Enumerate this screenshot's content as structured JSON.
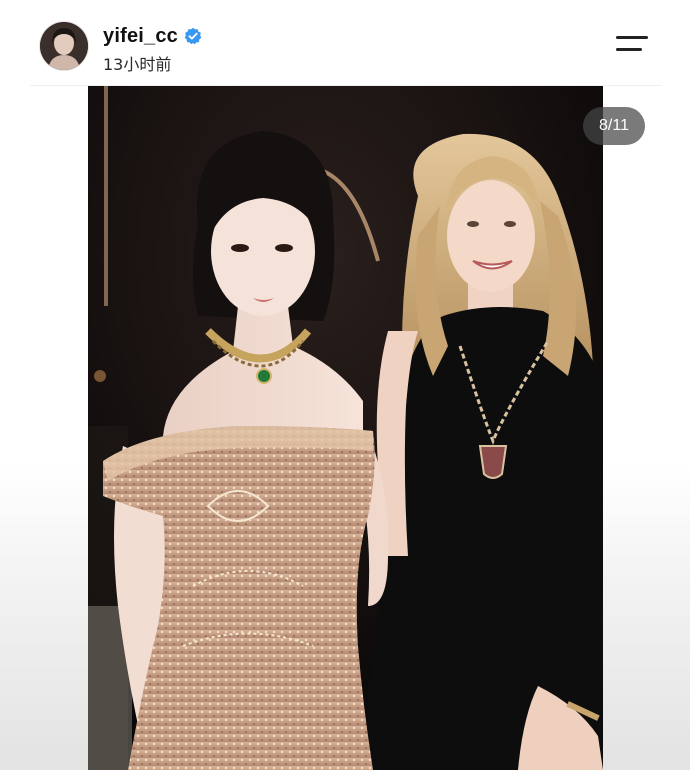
{
  "header": {
    "username": "yifei_cc",
    "verified_icon": "verified-badge-icon",
    "timestamp": "13小时前",
    "menu_icon": "menu-icon"
  },
  "post": {
    "image_description_icon": "photo",
    "page_counter": "8/11",
    "current_page": 8,
    "total_pages": 11
  },
  "colors": {
    "verified_blue": "#3897f0",
    "text_primary": "#111111",
    "counter_bg": "#464646"
  }
}
